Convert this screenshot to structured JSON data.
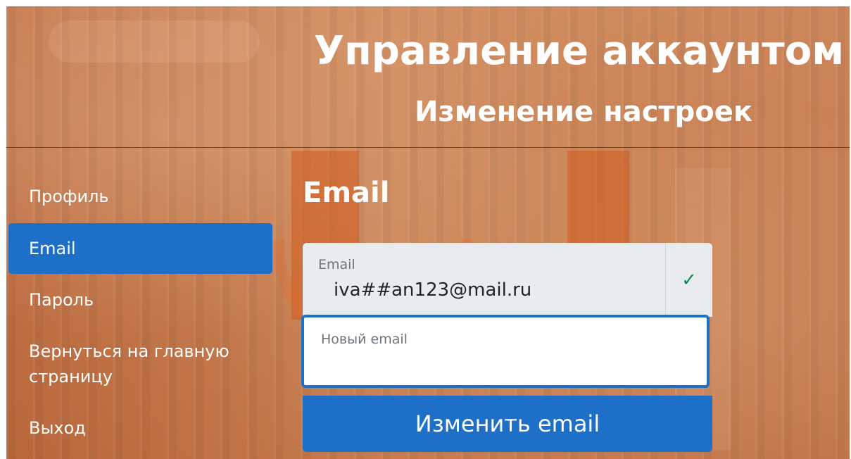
{
  "header": {
    "title": "Управление аккаунтом",
    "subtitle": "Изменение настроек"
  },
  "sidebar": {
    "items": [
      {
        "label": "Профиль",
        "active": false
      },
      {
        "label": "Email",
        "active": true
      },
      {
        "label": "Пароль",
        "active": false
      },
      {
        "label": "Вернуться на главную страницу",
        "active": false
      },
      {
        "label": "Выход",
        "active": false
      }
    ]
  },
  "main": {
    "section_title": "Email",
    "email_field": {
      "label": "Email",
      "value": "iva##an123@mail.ru",
      "status_icon": "checkmark-icon",
      "status_color": "#198754"
    },
    "new_email_field": {
      "label": "Новый email",
      "value": ""
    },
    "submit_label": "Изменить email"
  },
  "colors": {
    "accent": "#1e6fc8",
    "background": "#c97a4c"
  }
}
